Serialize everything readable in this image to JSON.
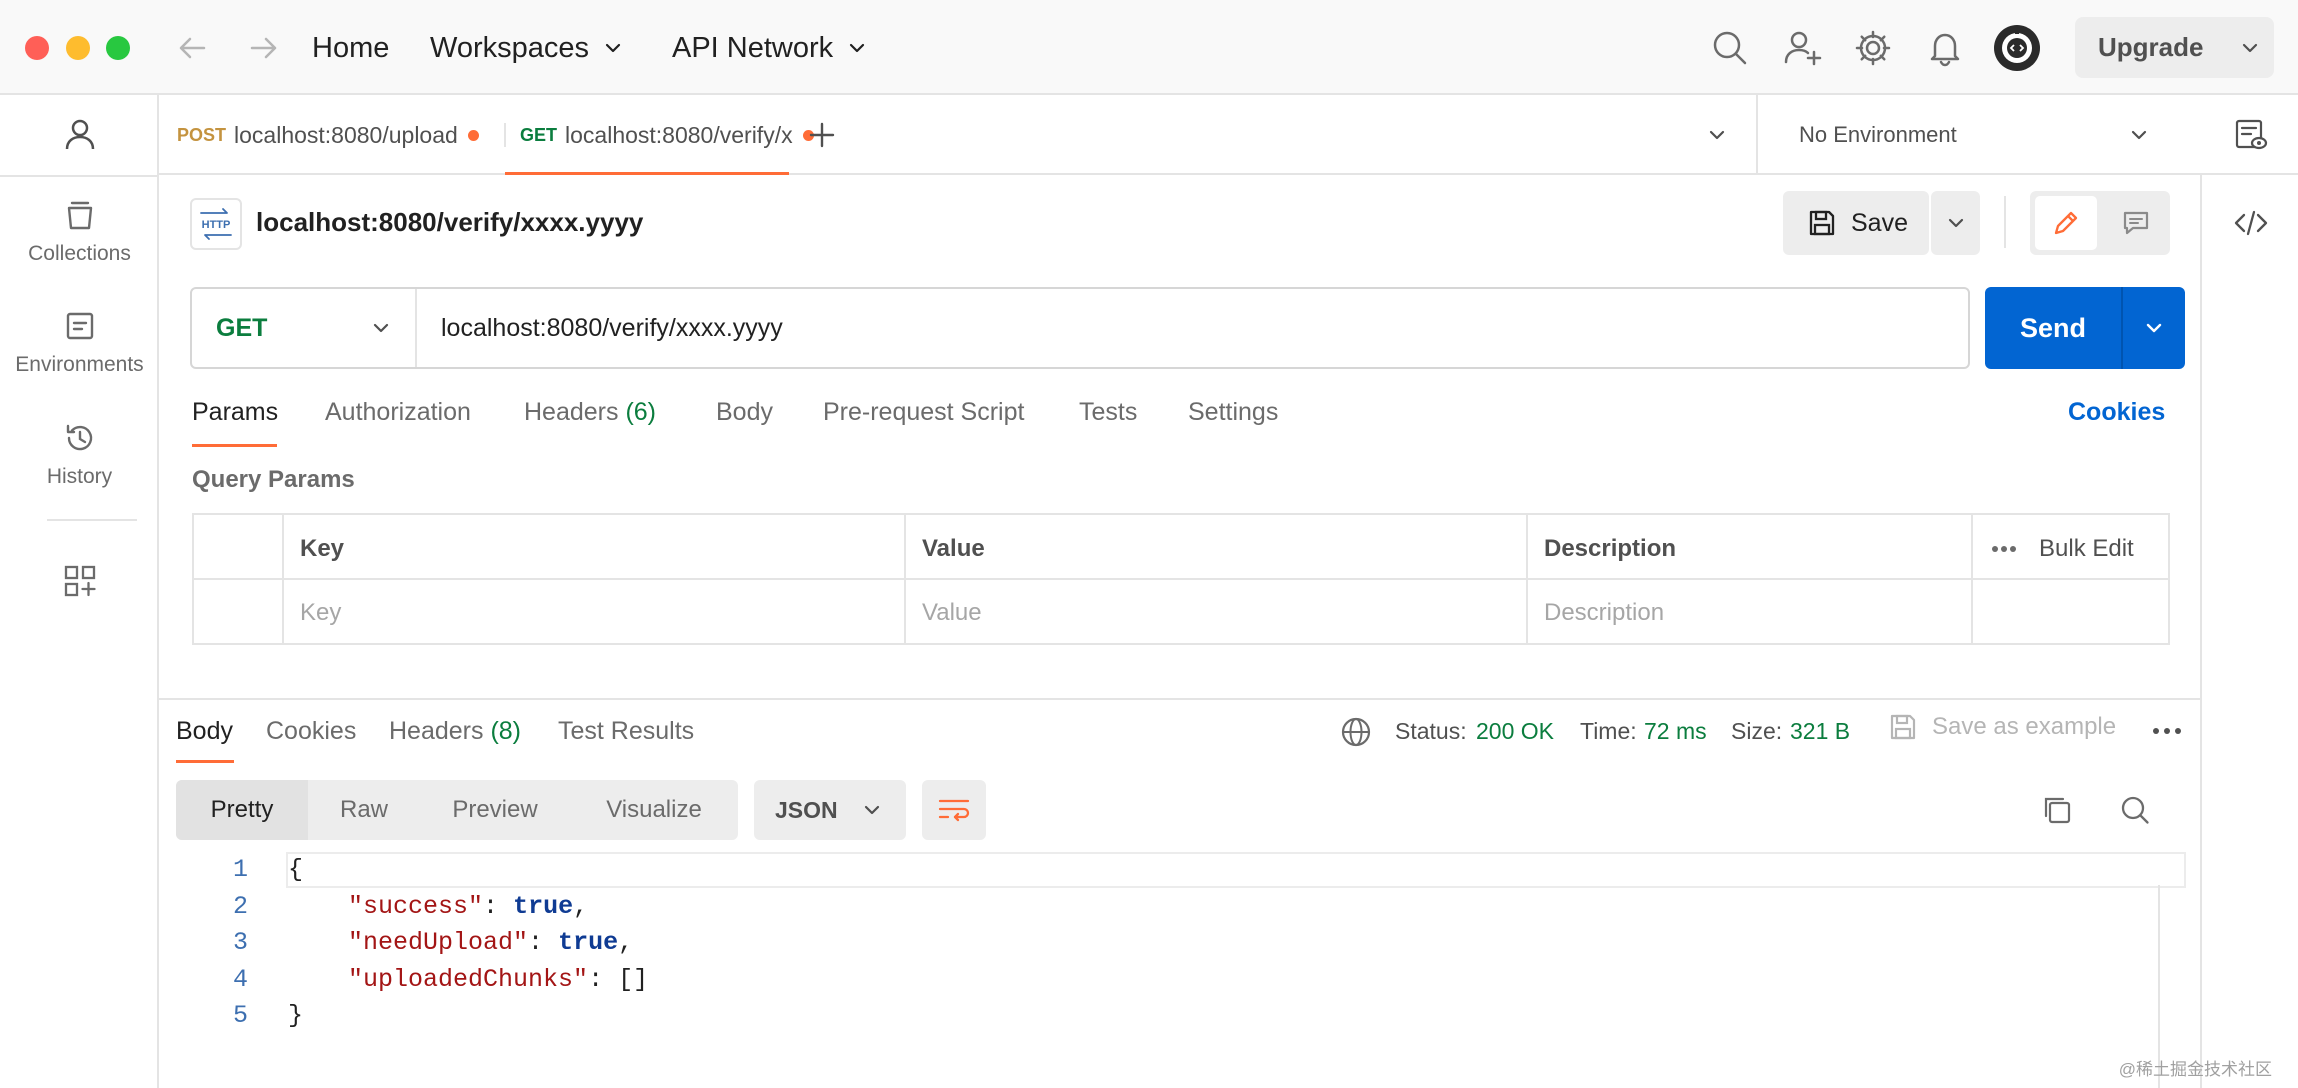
{
  "titlebar": {
    "home": "Home",
    "workspaces": "Workspaces",
    "api_network": "API Network",
    "upgrade": "Upgrade"
  },
  "sidebar": {
    "items": [
      {
        "label": "Collections",
        "icon": "collections-icon"
      },
      {
        "label": "Environments",
        "icon": "environments-icon"
      },
      {
        "label": "History",
        "icon": "history-icon"
      }
    ]
  },
  "tabs": [
    {
      "method": "POST",
      "label": "localhost:8080/upload",
      "method_color": "#c4933f"
    },
    {
      "method": "GET",
      "label": "localhost:8080/verify/x",
      "method_color": "#0b7d3e"
    }
  ],
  "environment": {
    "selected": "No Environment"
  },
  "request": {
    "title": "localhost:8080/verify/xxxx.yyyy",
    "method": "GET",
    "url": "localhost:8080/verify/xxxx.yyyy",
    "save": "Save",
    "send": "Send",
    "http_badge": "HTTP"
  },
  "request_tabs": {
    "params": "Params",
    "authorization": "Authorization",
    "headers": "Headers",
    "headers_count": "(6)",
    "body": "Body",
    "prerequest": "Pre-request Script",
    "tests": "Tests",
    "settings": "Settings",
    "cookies": "Cookies"
  },
  "query_params": {
    "title": "Query Params",
    "columns": [
      "Key",
      "Value",
      "Description"
    ],
    "placeholders": {
      "key": "Key",
      "value": "Value",
      "description": "Description"
    },
    "bulk_edit": "Bulk Edit"
  },
  "response": {
    "tabs": {
      "body": "Body",
      "cookies": "Cookies",
      "headers": "Headers",
      "headers_count": "(8)",
      "test_results": "Test Results"
    },
    "status_label": "Status:",
    "status_value": "200 OK",
    "time_label": "Time:",
    "time_value": "72 ms",
    "size_label": "Size:",
    "size_value": "321 B",
    "save_example": "Save as example",
    "views": [
      "Pretty",
      "Raw",
      "Preview",
      "Visualize"
    ],
    "format": "JSON",
    "code_lines": [
      {
        "n": "1",
        "tokens": [
          {
            "t": "{",
            "c": ""
          }
        ]
      },
      {
        "n": "2",
        "tokens": [
          {
            "t": "    ",
            "c": ""
          },
          {
            "t": "\"success\"",
            "c": "k"
          },
          {
            "t": ": ",
            "c": ""
          },
          {
            "t": "true",
            "c": "b"
          },
          {
            "t": ",",
            "c": ""
          }
        ]
      },
      {
        "n": "3",
        "tokens": [
          {
            "t": "    ",
            "c": ""
          },
          {
            "t": "\"needUpload\"",
            "c": "k"
          },
          {
            "t": ": ",
            "c": ""
          },
          {
            "t": "true",
            "c": "b"
          },
          {
            "t": ",",
            "c": ""
          }
        ]
      },
      {
        "n": "4",
        "tokens": [
          {
            "t": "    ",
            "c": ""
          },
          {
            "t": "\"uploadedChunks\"",
            "c": "k"
          },
          {
            "t": ": []",
            "c": ""
          }
        ]
      },
      {
        "n": "5",
        "tokens": [
          {
            "t": "}",
            "c": ""
          }
        ]
      }
    ]
  },
  "watermark": "@稀土掘金技术社区",
  "colors": {
    "accent": "#ff6c37",
    "send": "#0265d2",
    "success": "#0b7d3e"
  }
}
